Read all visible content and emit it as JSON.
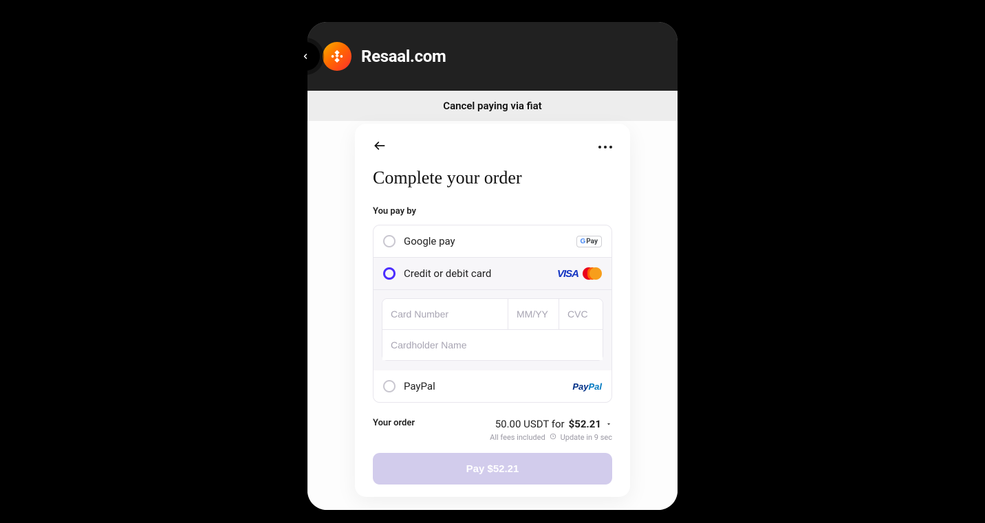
{
  "header": {
    "brand_name": "Resaal.com"
  },
  "cancel_bar": {
    "label": "Cancel paying via fiat"
  },
  "card": {
    "title": "Complete your order",
    "pay_by_label": "You pay by",
    "methods": {
      "google_pay": "Google pay",
      "credit_card": "Credit or debit card",
      "paypal": "PayPal"
    },
    "fields": {
      "card_number_placeholder": "Card Number",
      "expiry_placeholder": "MM/YY",
      "cvc_placeholder": "CVC",
      "cardholder_placeholder": "Cardholder Name"
    },
    "visa_text": "VISA",
    "gpay_badge": {
      "g": "G",
      "pay": "Pay"
    },
    "order": {
      "label": "Your order",
      "amount_line": "50.00 USDT for ",
      "price": "$52.21",
      "fees_text": "All fees included",
      "update_text": "Update in 9 sec"
    },
    "pay_button_label": "Pay $52.21"
  }
}
